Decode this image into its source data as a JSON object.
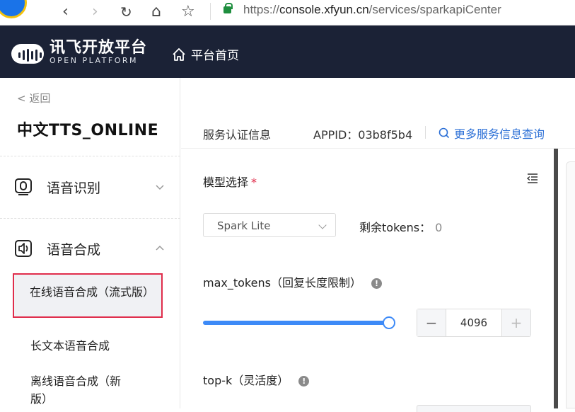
{
  "browser": {
    "url_prefix": "https://",
    "url_host": "console.xfyun.cn",
    "url_path": "/services/sparkapiCenter"
  },
  "header": {
    "brand_cn": "讯飞开放平台",
    "brand_en": "OPEN PLATFORM",
    "home_label": "平台首页",
    "bg_color": "#1b2236"
  },
  "sidebar": {
    "back_label": "< 返回",
    "service_title": "中文TTS_ONLINE",
    "groups": [
      {
        "label": "语音识别",
        "icon": "speech-recognition-icon",
        "expanded": false
      },
      {
        "label": "语音合成",
        "icon": "speech-synthesis-icon",
        "expanded": true
      }
    ],
    "sub_items": [
      {
        "label": "在线语音合成（流式版）",
        "active": true
      },
      {
        "label": "长文本语音合成",
        "active": false
      },
      {
        "label": "离线语音合成（新版）",
        "active": false
      }
    ],
    "highlight_color": "#e02d4b"
  },
  "main": {
    "auth_label": "服务认证信息",
    "appid": "APPID：03b8f5b4",
    "more_link": "更多服务信息查询",
    "model_label": "模型选择",
    "required_mark": "*",
    "model_value": "Spark Lite",
    "remain_label": "剩余tokens：",
    "remain_value": "0",
    "max_tokens_label": "max_tokens（回复长度限制）",
    "max_tokens_value": "4096",
    "max_tokens_slider_fraction": 1.0,
    "topk_label": "top-k（灵活度）",
    "accent_color": "#3d8af7"
  }
}
